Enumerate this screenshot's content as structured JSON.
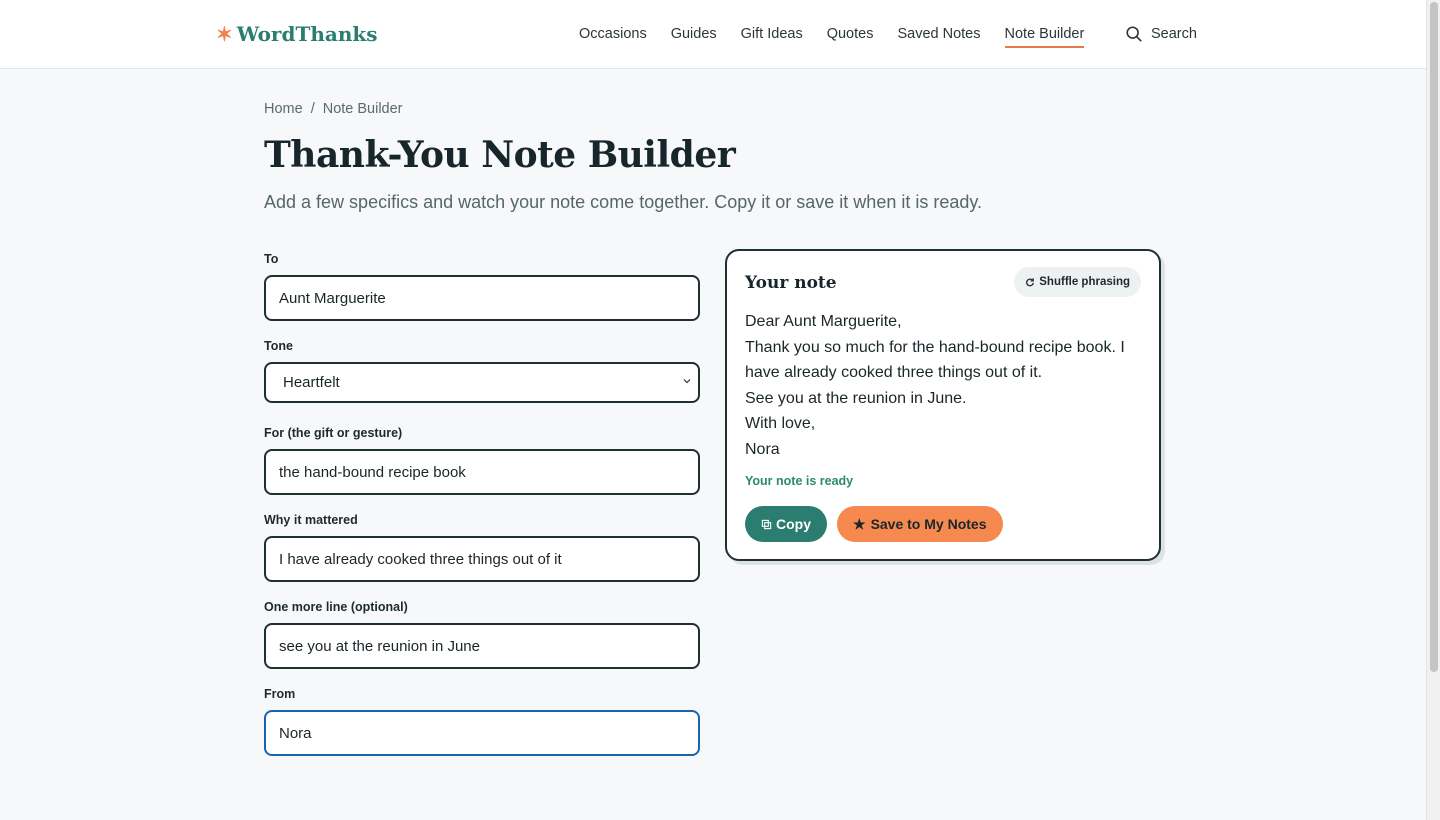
{
  "header": {
    "logo_text": "WordThanks",
    "nav": [
      "Occasions",
      "Guides",
      "Gift Ideas",
      "Quotes",
      "Saved Notes",
      "Note Builder"
    ],
    "active_nav": "Note Builder",
    "search_label": "Search"
  },
  "breadcrumb": {
    "home": "Home",
    "separator": "/",
    "current": "Note Builder"
  },
  "page": {
    "title": "Thank-You Note Builder",
    "subtitle": "Add a few specifics and watch your note come together. Copy it or save it when it is ready."
  },
  "form": {
    "to_label": "To",
    "to_value": "Aunt Marguerite",
    "tone_label": "Tone",
    "tone_value": "Heartfelt",
    "for_label": "For (the gift or gesture)",
    "for_value": "the hand-bound recipe book",
    "why_label": "Why it mattered",
    "why_value": "I have already cooked three things out of it",
    "more_label": "One more line (optional)",
    "more_value": "see you at the reunion in June",
    "from_label": "From",
    "from_value": "Nora"
  },
  "note": {
    "title": "Your note",
    "shuffle_label": "Shuffle phrasing",
    "lines": [
      "Dear Aunt Marguerite,",
      "Thank you so much for the hand-bound recipe book. I have already cooked three things out of it.",
      "See you at the reunion in June.",
      "With love,",
      "Nora"
    ],
    "status": "Your note is ready",
    "copy_label": "Copy",
    "save_label": "Save to My Notes"
  },
  "colors": {
    "brand": "#2a7d6f",
    "accent": "#f6894f",
    "focus": "#1a63b0",
    "status": "#2a8a6f"
  }
}
